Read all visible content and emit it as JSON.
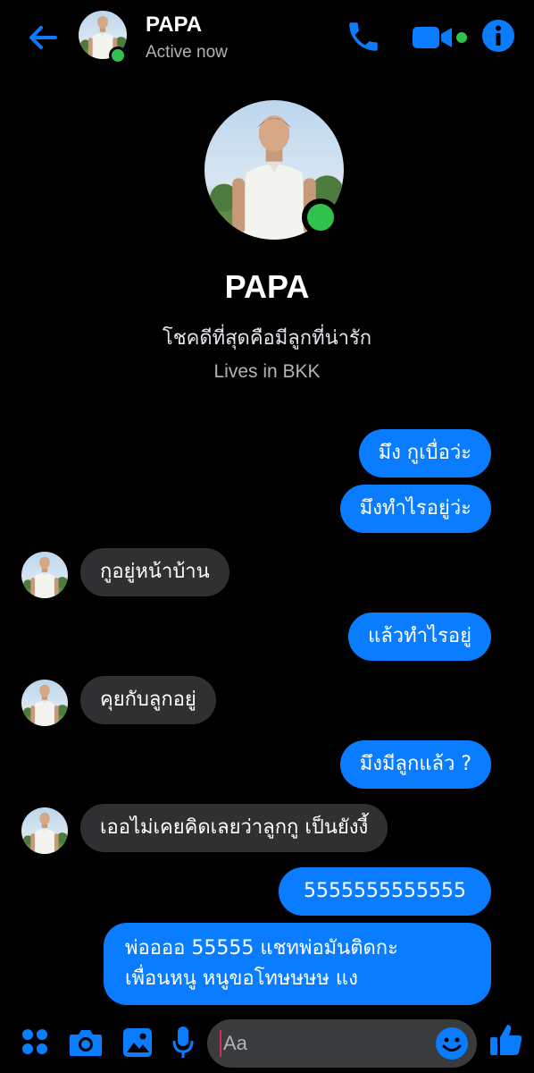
{
  "header": {
    "name": "PAPA",
    "status": "Active now"
  },
  "profile": {
    "name": "PAPA",
    "bio": "โชคดีที่สุดคือมีลูกที่น่ารัก",
    "location": "Lives in BKK"
  },
  "messages": [
    {
      "from": "me",
      "text": "มึง กูเบื่อว่ะ"
    },
    {
      "from": "me",
      "text": "มึงทำไรอยู่ว่ะ"
    },
    {
      "from": "papa",
      "text": "กูอยู่หน้าบ้าน"
    },
    {
      "from": "me",
      "text": "แล้วทำไรอยู่"
    },
    {
      "from": "papa",
      "text": "คุยกับลูกอยู่"
    },
    {
      "from": "me",
      "text": "มึงมีลูกแล้ว ?"
    },
    {
      "from": "papa",
      "text": "เออไม่เคยคิดเลยว่าลูกกู เป็นยังงี้"
    },
    {
      "from": "me",
      "text": "5555555555555"
    },
    {
      "from": "me",
      "text": "พ่ออออ 55555 แชทพ่อมันติดกะ เพื่อนหนู หนูขอโทษษษษ แง",
      "line1": "พ่ออออ 55555 แชทพ่อมันติดกะ",
      "line2": "เพื่อนหนู หนูขอโทษษษษ แง"
    }
  ],
  "composer": {
    "placeholder": "Aa"
  },
  "icons": {
    "back": "back-arrow-icon",
    "call": "phone-icon",
    "video": "video-camera-icon",
    "info": "info-icon",
    "menu": "four-dots-icon",
    "camera": "camera-icon",
    "gallery": "image-icon",
    "mic": "microphone-icon",
    "emoji": "smiley-icon",
    "like": "thumbs-up-icon"
  },
  "colors": {
    "accent": "#0a7cff",
    "online": "#31c24d",
    "incoming_bubble": "#303033",
    "background": "#000000"
  }
}
